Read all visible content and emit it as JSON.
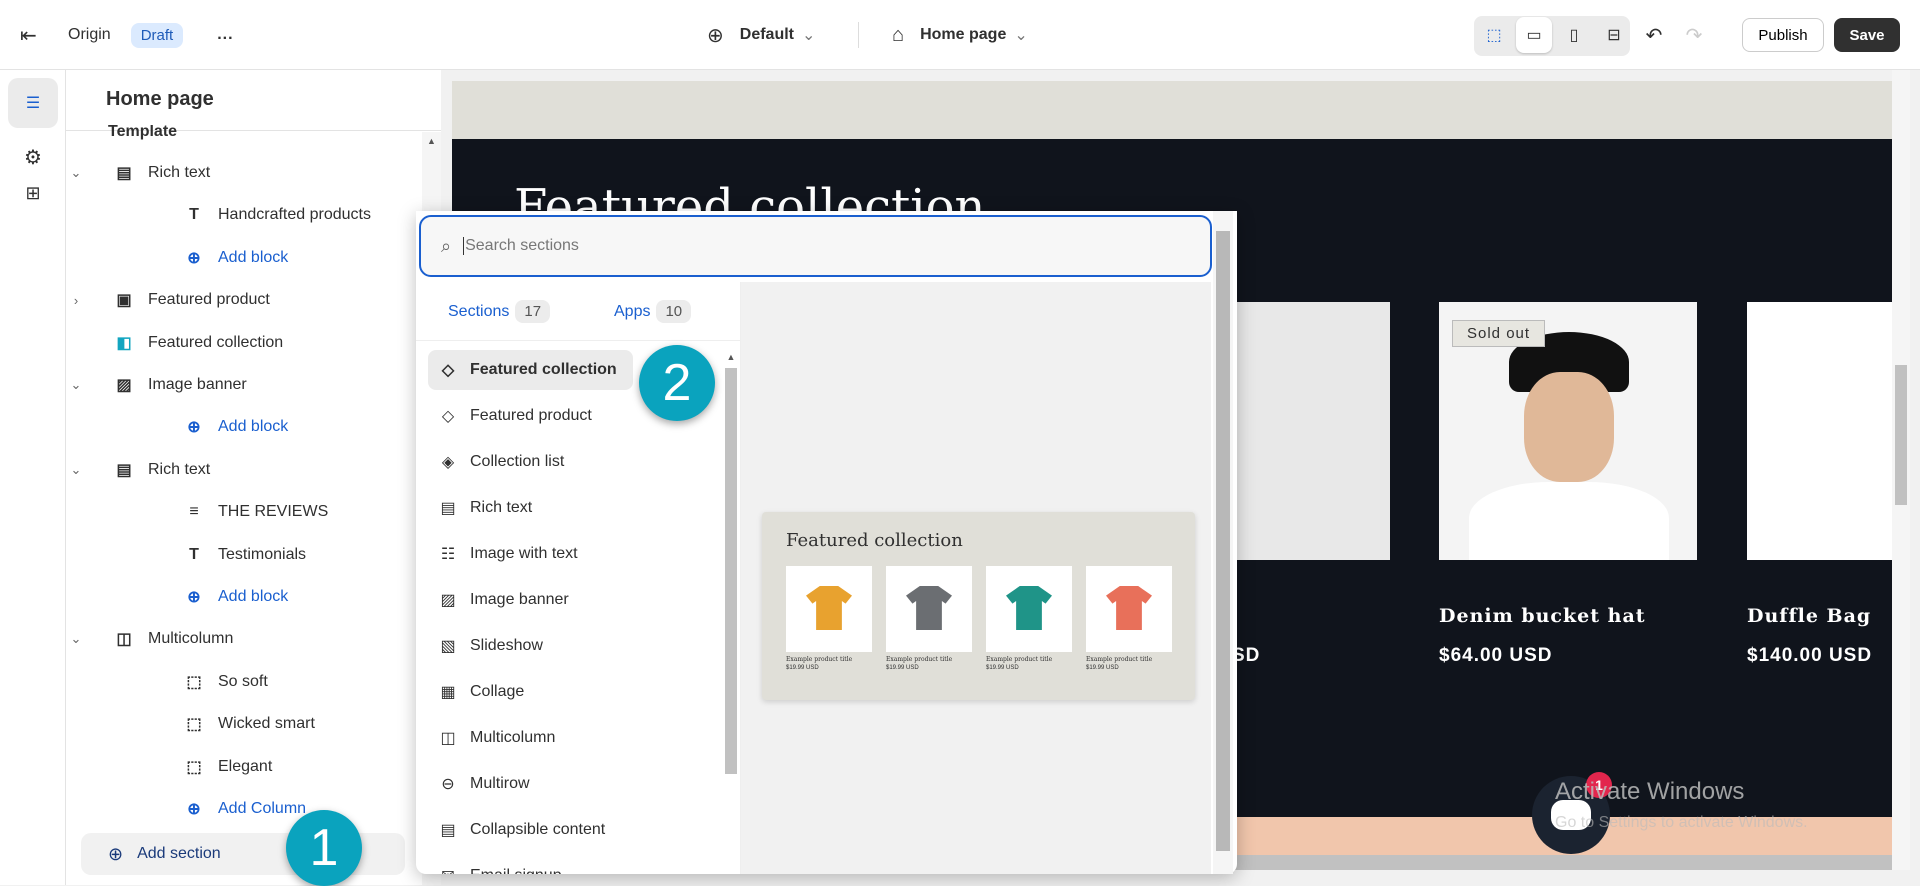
{
  "topbar": {
    "back": "exit-icon",
    "store": "Origin",
    "status": "Draft",
    "more": "...",
    "theme": "Default",
    "page": "Home page",
    "publish": "Publish",
    "save": "Save"
  },
  "sidebar": {
    "title": "Home page",
    "template": "Template",
    "items": [
      {
        "label": "Rich text",
        "icon": "text-block-icon",
        "level": 0,
        "chevron": "down"
      },
      {
        "label": "Handcrafted products",
        "icon": "heading-icon",
        "level": 1
      },
      {
        "label": "Add block",
        "icon": "plus-circle-icon",
        "level": 1,
        "link": true
      },
      {
        "label": "Featured product",
        "icon": "product-thumb-icon",
        "level": 0,
        "chevron": "right"
      },
      {
        "label": "Featured collection",
        "icon": "collection-app-icon",
        "level": 0
      },
      {
        "label": "Image banner",
        "icon": "image-icon",
        "level": 0,
        "chevron": "down"
      },
      {
        "label": "Add block",
        "icon": "plus-circle-icon",
        "level": 1,
        "link": true
      },
      {
        "label": "Rich text",
        "icon": "text-block-icon",
        "level": 0,
        "chevron": "down"
      },
      {
        "label": "THE REVIEWS",
        "icon": "paragraph-icon",
        "level": 1
      },
      {
        "label": "Testimonials",
        "icon": "heading-icon",
        "level": 1
      },
      {
        "label": "Add block",
        "icon": "plus-circle-icon",
        "level": 1,
        "link": true
      },
      {
        "label": "Multicolumn",
        "icon": "columns-icon",
        "level": 0,
        "chevron": "down"
      },
      {
        "label": "So soft",
        "icon": "column-icon",
        "level": 1
      },
      {
        "label": "Wicked smart",
        "icon": "column-icon",
        "level": 1
      },
      {
        "label": "Elegant",
        "icon": "column-icon",
        "level": 1
      },
      {
        "label": "Add Column",
        "icon": "plus-circle-icon",
        "level": 1,
        "link": true
      }
    ],
    "add_section": "Add section"
  },
  "callouts": {
    "one": "1",
    "two": "2"
  },
  "popup": {
    "search_placeholder": "Search sections",
    "tabs": [
      {
        "label": "Sections",
        "count": "17"
      },
      {
        "label": "Apps",
        "count": "10"
      }
    ],
    "items": [
      "Featured collection",
      "Featured product",
      "Collection list",
      "Rich text",
      "Image with text",
      "Image banner",
      "Slideshow",
      "Collage",
      "Multicolumn",
      "Multirow",
      "Collapsible content",
      "Email signup"
    ],
    "preview": {
      "title": "Featured collection",
      "product_title": "Example product title",
      "product_price": "$19.99 USD",
      "shirt_colors": [
        "#e8a22f",
        "#6b6e72",
        "#1f9488",
        "#e8705a"
      ]
    }
  },
  "store": {
    "heading": "Featured collection",
    "products": [
      {
        "title": "",
        "price": "SD"
      },
      {
        "title": "Denim bucket hat",
        "price": "$64.00 USD",
        "badge": "Sold out"
      },
      {
        "title": "Duffle Bag",
        "price": "$140.00 USD"
      }
    ],
    "chat_count": "1"
  },
  "watermark": {
    "line1": "Activate Windows",
    "line2": "Go to Settings to activate Windows."
  }
}
